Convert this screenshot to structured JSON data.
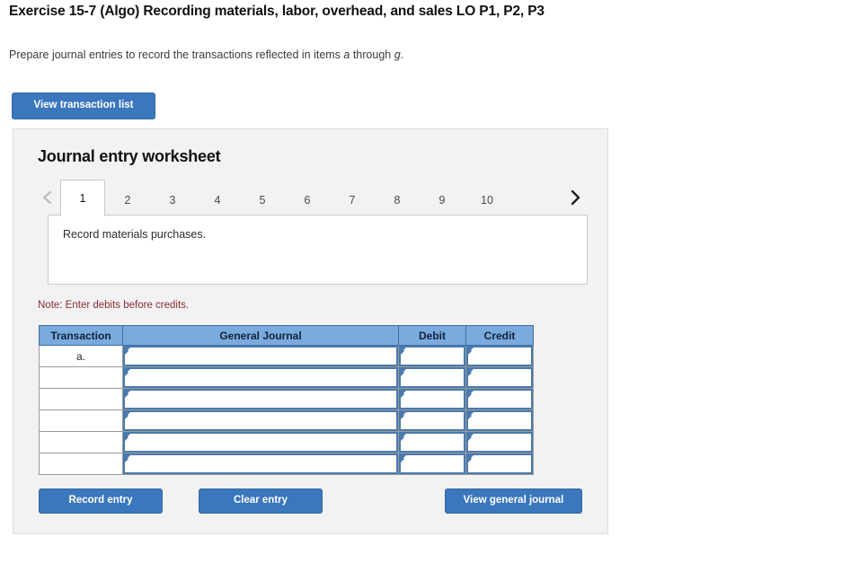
{
  "exercise": {
    "title": "Exercise 15-7 (Algo) Recording materials, labor, overhead, and sales LO P1, P2, P3",
    "instructions_before": "Prepare journal entries to record the transactions reflected in items ",
    "instructions_italic_a": "a",
    "instructions_middle": " through ",
    "instructions_italic_g": "g",
    "instructions_after": "."
  },
  "toolbar": {
    "view_transaction_list_label": "View transaction list"
  },
  "worksheet": {
    "title": "Journal entry worksheet",
    "prev_arrow_icon": "chevron-left-icon",
    "next_arrow_icon": "chevron-right-icon",
    "tabs": [
      {
        "label": "1",
        "active": true
      },
      {
        "label": "2",
        "active": false
      },
      {
        "label": "3",
        "active": false
      },
      {
        "label": "4",
        "active": false
      },
      {
        "label": "5",
        "active": false
      },
      {
        "label": "6",
        "active": false
      },
      {
        "label": "7",
        "active": false
      },
      {
        "label": "8",
        "active": false
      },
      {
        "label": "9",
        "active": false
      },
      {
        "label": "10",
        "active": false
      }
    ],
    "description": "Record materials purchases.",
    "note": "Note: Enter debits before credits."
  },
  "journal": {
    "columns": [
      "Transaction",
      "General Journal",
      "Debit",
      "Credit"
    ],
    "rows": [
      {
        "transaction": "a.",
        "general_journal": "",
        "debit": "",
        "credit": ""
      },
      {
        "transaction": "",
        "general_journal": "",
        "debit": "",
        "credit": ""
      },
      {
        "transaction": "",
        "general_journal": "",
        "debit": "",
        "credit": ""
      },
      {
        "transaction": "",
        "general_journal": "",
        "debit": "",
        "credit": ""
      },
      {
        "transaction": "",
        "general_journal": "",
        "debit": "",
        "credit": ""
      },
      {
        "transaction": "",
        "general_journal": "",
        "debit": "",
        "credit": ""
      }
    ]
  },
  "actions": {
    "record_entry_label": "Record entry",
    "clear_entry_label": "Clear entry",
    "view_general_journal_label": "View general journal"
  },
  "colors": {
    "button_blue": "#3a77bd",
    "table_header_blue": "#7aaade",
    "panel_gray": "#f2f2f2",
    "note_red": "#8b2b3a",
    "input_border_blue": "#4a7aad"
  }
}
